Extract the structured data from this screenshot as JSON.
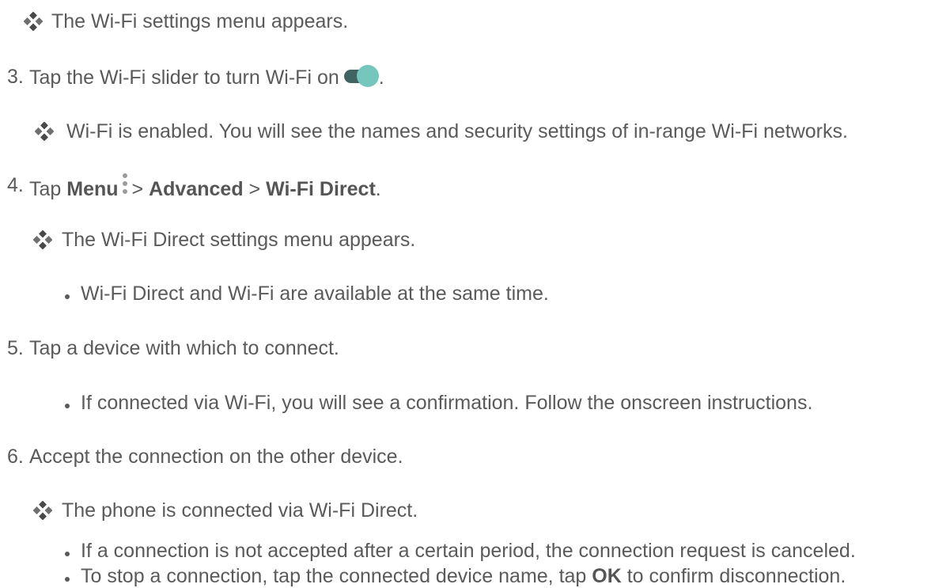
{
  "steps": {
    "result_menu_appears": "The Wi-Fi settings menu appears.",
    "step3": {
      "number": "3.",
      "text": "Tap the Wi-Fi slider to turn Wi-Fi on",
      "end": "."
    },
    "result_wifi_enabled": "Wi-Fi is enabled. You will see the names and security settings of in-range Wi-Fi networks.",
    "step4": {
      "number": "4.",
      "tap": "Tap",
      "menu": "Menu",
      "sep1": ">",
      "advanced": "Advanced",
      "sep2": ">",
      "wifi_direct": "Wi-Fi Direct",
      "end": "."
    },
    "result_direct_menu": "The Wi-Fi Direct settings menu appears.",
    "bullet_available": "Wi-Fi Direct and Wi-Fi are available at the same time.",
    "step5": {
      "number": "5.",
      "text": "Tap a device with which to connect."
    },
    "bullet_confirmation": "If connected via Wi-Fi, you will see a confirmation. Follow the onscreen instructions.",
    "step6": {
      "number": "6.",
      "text": "Accept the connection on the other device."
    },
    "result_connected": "The phone is connected via Wi-Fi Direct.",
    "bullet_canceled": "If a connection is not accepted after a certain period, the connection request is canceled.",
    "bullet_stop": {
      "before": "To stop a connection, tap the connected device name, tap",
      "ok": "OK",
      "after": "to confirm disconnection."
    }
  },
  "colors": {
    "text": "#5a5a5a",
    "icon_dark": "#484848",
    "icon_light": "#6f6f6f",
    "toggle_track": "#3f6461",
    "toggle_knob": "#75c6bd",
    "menu_dots": "#9a9a9a"
  },
  "icons": {
    "result": "four-diamond-result-icon",
    "toggle": "toggle-on-icon",
    "menu": "vertical-dots-menu-icon",
    "bullet": "bullet-dot-icon"
  }
}
